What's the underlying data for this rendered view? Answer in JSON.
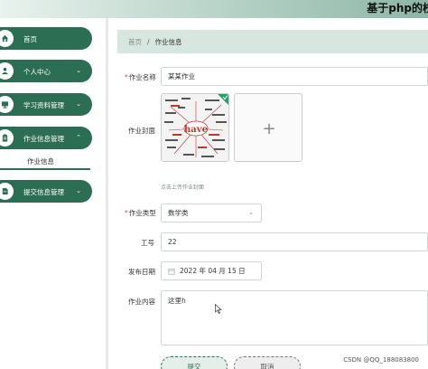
{
  "header": {
    "site_title": "基于php的校"
  },
  "sidebar": {
    "items": [
      {
        "label": "首页",
        "icon": "home-icon"
      },
      {
        "label": "个人中心",
        "icon": "user-icon"
      },
      {
        "label": "学习资料管理",
        "icon": "monitor-icon"
      },
      {
        "label": "作业信息管理",
        "icon": "clipboard-icon"
      },
      {
        "label": "提交信息管理",
        "icon": "file-icon"
      }
    ],
    "active_sub_item": "作业信息"
  },
  "breadcrumb": {
    "home": "首页",
    "separator": "/",
    "current": "作业信息"
  },
  "form": {
    "title_label": "作业名称",
    "title_value": "某某作业",
    "cover_label": "作业封面",
    "cover_image_text": "have",
    "upload_tip": "点击上传作业封面",
    "type_label": "作业类型",
    "type_value": "数学类",
    "id_label": "工号",
    "id_value": "22",
    "date_label": "发布日期",
    "date_value": "2022 年 04 月 15 日",
    "content_label": "作业内容",
    "content_value": "这里h",
    "submit_label": "提交",
    "cancel_label": "取消"
  },
  "watermark": "CSDN @QQ_188083800",
  "colors": {
    "primary": "#2c6e54",
    "breadcrumb_bg": "#d7e7e0",
    "required": "#e34949"
  }
}
